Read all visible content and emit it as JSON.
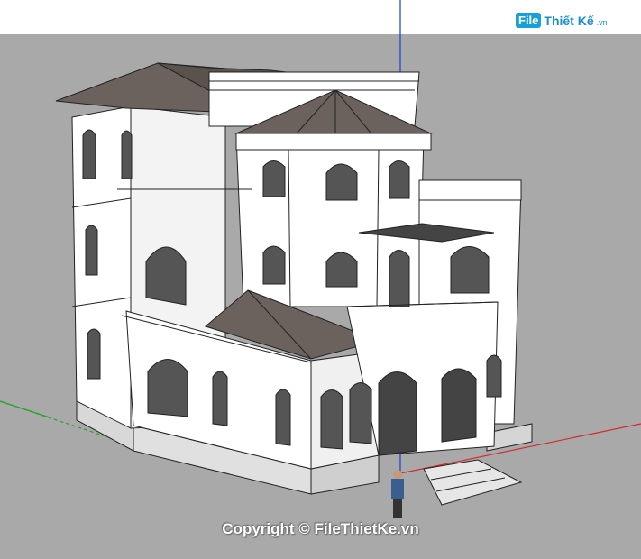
{
  "watermark": {
    "logo_box": "File",
    "logo_text": "Thiết Kế",
    "logo_tld": ".vn",
    "copyright": "Copyright © FileThietKe.vn"
  },
  "colors": {
    "sky": "#ffffff",
    "ground": "#a9a9a9",
    "roof": "#6b625d",
    "wall": "#ffffff",
    "edge": "#222222",
    "axis_blue": "#1a3cd8",
    "axis_red": "#d52a2a",
    "axis_green": "#29a329",
    "brand": "#1a8fd0"
  }
}
